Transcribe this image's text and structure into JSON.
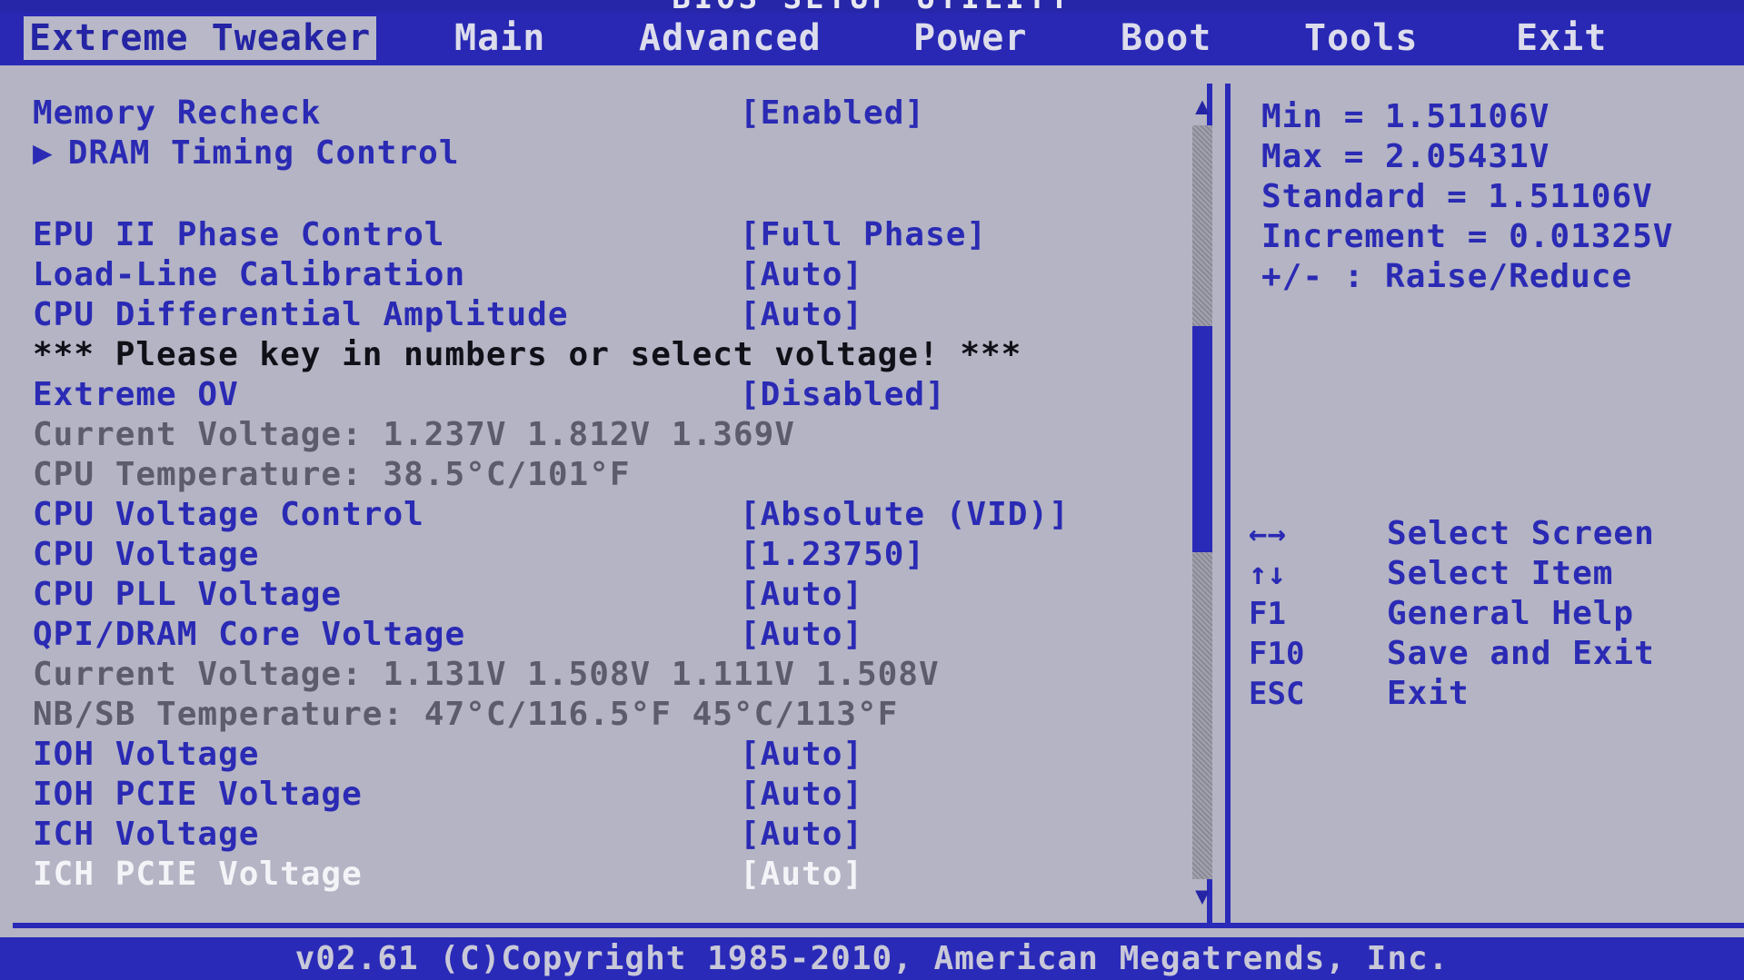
{
  "title": "BIOS SETUP UTILITY",
  "menu": [
    {
      "label": "Extreme Tweaker",
      "active": true
    },
    {
      "label": "Main"
    },
    {
      "label": "Advanced"
    },
    {
      "label": "Power"
    },
    {
      "label": "Boot"
    },
    {
      "label": "Tools"
    },
    {
      "label": "Exit"
    }
  ],
  "settings": {
    "memory_recheck": {
      "label": "Memory Recheck",
      "value": "[Enabled]"
    },
    "dram_timing": {
      "label": "DRAM Timing Control",
      "arrow": "▶"
    },
    "epu_phase": {
      "label": "EPU II Phase Control",
      "value": "[Full Phase]"
    },
    "load_line": {
      "label": "Load-Line Calibration",
      "value": "[Auto]"
    },
    "cpu_diff_amp": {
      "label": "CPU Differential Amplitude",
      "value": "[Auto]"
    },
    "note": "*** Please key in numbers or select voltage! ***",
    "extreme_ov": {
      "label": "Extreme OV",
      "value": "[Disabled]"
    },
    "current_voltage_1": "Current Voltage: 1.237V  1.812V  1.369V",
    "cpu_temp": "CPU Temperature: 38.5°C/101°F",
    "cpu_voltage_control": {
      "label": "CPU Voltage Control",
      "value": "[Absolute (VID)]"
    },
    "cpu_voltage": {
      "label": "CPU Voltage",
      "value": "[1.23750]"
    },
    "cpu_pll_voltage": {
      "label": "CPU PLL Voltage",
      "value": "[Auto]"
    },
    "qpi_dram_voltage": {
      "label": "QPI/DRAM Core Voltage",
      "value": "[Auto]"
    },
    "current_voltage_2": "Current Voltage: 1.131V  1.508V  1.111V  1.508V",
    "nbsb_temp": "NB/SB Temperature: 47°C/116.5°F  45°C/113°F",
    "ioh_voltage": {
      "label": "IOH Voltage",
      "value": "[Auto]"
    },
    "ioh_pcie_voltage": {
      "label": "IOH PCIE Voltage",
      "value": "[Auto]"
    },
    "ich_voltage": {
      "label": "ICH Voltage",
      "value": "[Auto]"
    },
    "ich_pcie_voltage": {
      "label": "ICH PCIE Voltage",
      "value": "[Auto]"
    }
  },
  "scrollbar": {
    "up": "▲",
    "down": "▼",
    "thumb_position": 0.38,
    "thumb_fraction": 0.3
  },
  "help": {
    "min": "Min = 1.51106V",
    "max": "Max = 2.05431V",
    "standard": "Standard  = 1.51106V",
    "increment": "Increment = 0.01325V",
    "raise_reduce": "+/- : Raise/Reduce"
  },
  "keys": [
    {
      "key": "←→",
      "desc": "Select Screen"
    },
    {
      "key": "↑↓",
      "desc": "Select Item"
    },
    {
      "key": "F1",
      "desc": "General Help"
    },
    {
      "key": "F10",
      "desc": "Save and Exit"
    },
    {
      "key": "ESC",
      "desc": "Exit"
    }
  ],
  "footer": "v02.61 (C)Copyright 1985-2010, American Megatrends, Inc.",
  "colors": {
    "blue": "#2a2ab8",
    "panel_gray": "#b4b4c4",
    "text_blue": "#2a2ab4",
    "selected_white": "#f4f4f8"
  }
}
